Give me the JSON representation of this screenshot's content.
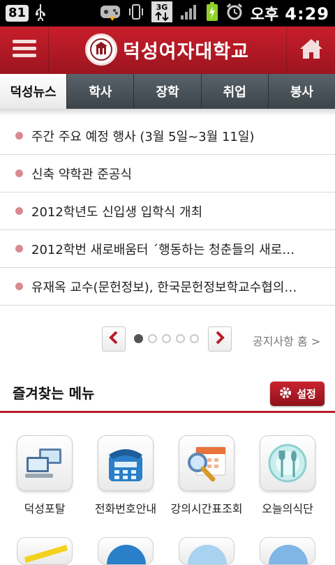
{
  "status_bar": {
    "battery_level": "81",
    "ampm": "오후",
    "time": "4:29",
    "network": "3G"
  },
  "header": {
    "title": "덕성여자대학교"
  },
  "tabs": [
    {
      "label": "덕성뉴스",
      "active": true
    },
    {
      "label": "학사",
      "active": false
    },
    {
      "label": "장학",
      "active": false
    },
    {
      "label": "취업",
      "active": false
    },
    {
      "label": "봉사",
      "active": false
    }
  ],
  "news": [
    {
      "title": "주간 주요 예정 행사 (3월 5일~3월 11일)"
    },
    {
      "title": "신축 약학관 준공식"
    },
    {
      "title": "2012학년도 신입생 입학식 개최"
    },
    {
      "title": "2012학번 새로배움터 ´행동하는 청춘들의 새로…"
    },
    {
      "title": "유재옥 교수(문헌정보), 한국문헌정보학교수협의…"
    }
  ],
  "pager": {
    "current_page": 1,
    "total_pages": 5,
    "notice_home_label": "공지사항 홈 >"
  },
  "favorites": {
    "title": "즐겨찾는 메뉴",
    "settings_label": "설정",
    "items": [
      {
        "label": "덕성포탈",
        "icon": "computer-icon"
      },
      {
        "label": "전화번호안내",
        "icon": "phone-icon"
      },
      {
        "label": "강의시간표조회",
        "icon": "calendar-search-icon"
      },
      {
        "label": "오늘의식단",
        "icon": "dining-icon"
      }
    ]
  },
  "colors": {
    "brand_red": "#b81d28",
    "tab_dark": "#3c444a",
    "bullet": "#d88a90"
  }
}
